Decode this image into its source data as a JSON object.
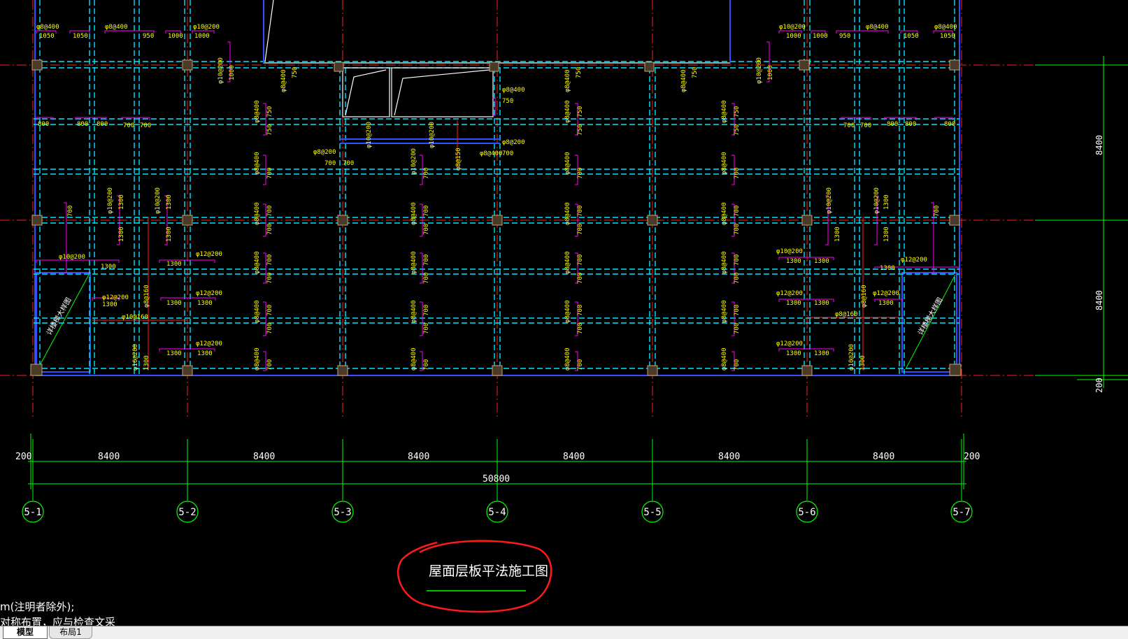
{
  "drawing": {
    "title": "屋面层板平法施工图",
    "note_line1": "m(注明者除外);",
    "note_line2": "对称布置，应与检查文采",
    "axes": [
      "5-1",
      "5-2",
      "5-3",
      "5-4",
      "5-5",
      "5-6",
      "5-7"
    ],
    "bay_labels": [
      "8400",
      "8400",
      "8400",
      "8400",
      "8400",
      "8400"
    ],
    "edge_labels": [
      "200",
      "200"
    ],
    "total_label": "50800",
    "right_dims": [
      "8400",
      "8400",
      "200"
    ],
    "stair_label": "详楼梯大样图",
    "colors": {
      "grid": "#00ff00",
      "axis": "#ff0000",
      "beam": "#00e5ff",
      "rebar": "#ff00ff",
      "text": "#ffff00",
      "wall": "#3050ff"
    }
  },
  "rebar_labels": {
    "top_left": [
      "φ8@400",
      "1050",
      "1050",
      "φ8@400",
      "950",
      "1000",
      "φ10@200",
      "1000"
    ],
    "top_right": [
      "φ10@200",
      "1000",
      "1000",
      "950",
      "φ8@400",
      "1050",
      "φ8@400",
      "1050"
    ],
    "left_row2": [
      "800",
      "800",
      "800",
      "700",
      "700"
    ],
    "right_row2": [
      "700",
      "700",
      "800",
      "800",
      "800"
    ],
    "center": [
      "φ8@400",
      "750",
      "φ8@200",
      "700",
      "φ8@200",
      "700",
      "700",
      "φ10@200",
      "φ8@150",
      "φ8@400",
      "700",
      "φ8@400",
      "700"
    ],
    "side": [
      "φ12@200",
      "1300",
      "φ10@200",
      "1300",
      "φ12@200",
      "1300",
      "φ10@160",
      "φ8@160",
      "1000",
      "φ10@200",
      "700",
      "1300",
      "φ12@200",
      "1300"
    ]
  },
  "tabs": {
    "model": "模型",
    "layout1": "布局1"
  }
}
